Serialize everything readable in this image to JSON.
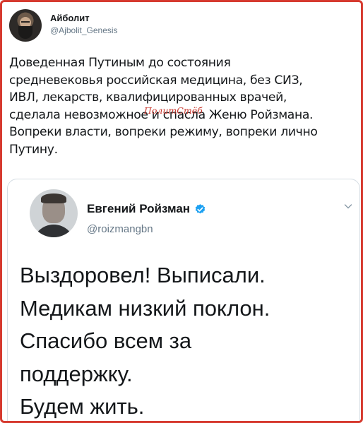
{
  "tweet": {
    "author_name": "Айболит",
    "author_handle": "@Ajbolit_Genesis",
    "text_lines": [
      "Доведенная Путиным до  состояния",
      "средневековья российская медицина, без СИЗ,",
      "ИВЛ, лекарств, квалифицированных врачей,",
      "сделала невозможное и спасла Женю Ройзмана.",
      "Вопреки власти, вопреки режиму, вопреки лично",
      "Путину."
    ]
  },
  "watermark": "ПолитСтёб",
  "quoted_tweet": {
    "author_name": "Евгений Ройзман",
    "author_handle": "@roizmangbn",
    "verified": true,
    "text_lines": [
      "Выздоровел! Выписали.",
      "Медикам низкий поклон.",
      "Спасибо всем за",
      "поддержку.",
      "Будем жить."
    ]
  },
  "colors": {
    "frame_border": "#d63a2f",
    "verified_badge": "#1da1f2",
    "secondary_text": "#657786"
  }
}
